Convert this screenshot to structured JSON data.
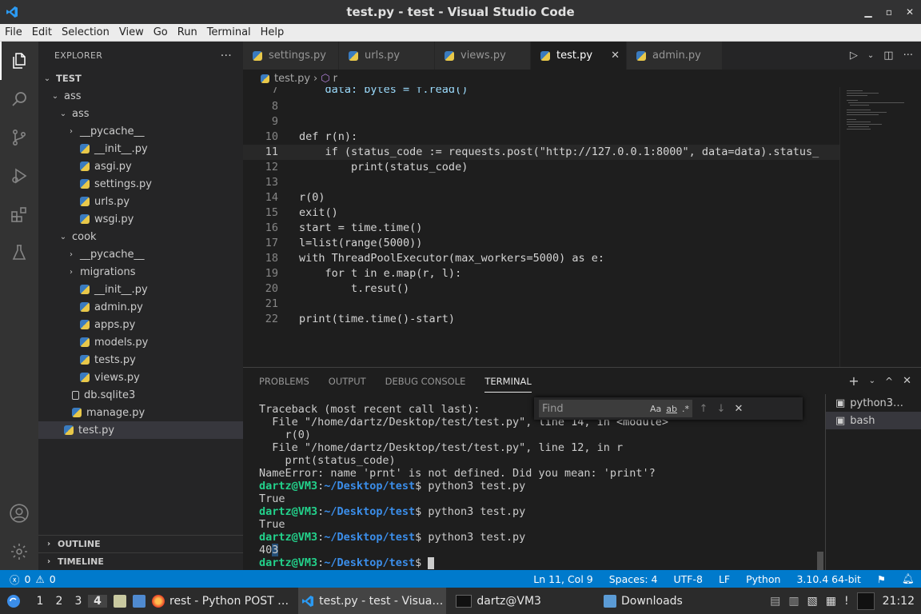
{
  "window": {
    "title": "test.py - test - Visual Studio Code"
  },
  "menu": [
    "File",
    "Edit",
    "Selection",
    "View",
    "Go",
    "Run",
    "Terminal",
    "Help"
  ],
  "explorer": {
    "header": "EXPLORER",
    "root": "TEST",
    "items": [
      {
        "label": "ass",
        "type": "folder-open"
      },
      {
        "label": "ass",
        "type": "folder-open"
      },
      {
        "label": "__pycache__",
        "type": "folder"
      },
      {
        "label": "__init__.py",
        "type": "py"
      },
      {
        "label": "asgi.py",
        "type": "py"
      },
      {
        "label": "settings.py",
        "type": "py"
      },
      {
        "label": "urls.py",
        "type": "py"
      },
      {
        "label": "wsgi.py",
        "type": "py"
      },
      {
        "label": "cook",
        "type": "folder-open"
      },
      {
        "label": "__pycache__",
        "type": "folder"
      },
      {
        "label": "migrations",
        "type": "folder"
      },
      {
        "label": "__init__.py",
        "type": "py"
      },
      {
        "label": "admin.py",
        "type": "py"
      },
      {
        "label": "apps.py",
        "type": "py"
      },
      {
        "label": "models.py",
        "type": "py"
      },
      {
        "label": "tests.py",
        "type": "py"
      },
      {
        "label": "views.py",
        "type": "py"
      },
      {
        "label": "db.sqlite3",
        "type": "db"
      },
      {
        "label": "manage.py",
        "type": "py"
      },
      {
        "label": "test.py",
        "type": "py"
      }
    ],
    "outline": "OUTLINE",
    "timeline": "TIMELINE"
  },
  "tabs": [
    "settings.py",
    "urls.py",
    "views.py",
    "test.py",
    "admin.py"
  ],
  "active_tab": "test.py",
  "breadcrumb": {
    "file": "test.py",
    "separator": "›",
    "symbol": "r"
  },
  "code": {
    "line_numbers": [
      "7",
      "8",
      "9",
      "10",
      "11",
      "12",
      "13",
      "14",
      "15",
      "16",
      "17",
      "18",
      "19",
      "20",
      "21",
      "22"
    ],
    "line7": "    data: bytes = f.read()",
    "line10": "def r(n):",
    "line11": "    if (status_code := requests.post(\"http://127.0.0.1:8000\", data=data).status_",
    "line12": "        print(status_code)",
    "line14": "r(0)",
    "line15": "exit()",
    "line16": "start = time.time()",
    "line17": "l=list(range(5000))",
    "line18": "with ThreadPoolExecutor(max_workers=5000) as e:",
    "line19": "    for t in e.map(r, l):",
    "line20": "        t.resut()",
    "line22": "print(time.time()-start)"
  },
  "panel": {
    "tabs": [
      "PROBLEMS",
      "OUTPUT",
      "DEBUG CONSOLE",
      "TERMINAL"
    ],
    "active": "TERMINAL",
    "find_placeholder": "Find",
    "find_opts": [
      "Aa",
      "ab",
      ".*"
    ],
    "terminal_lines": [
      "Traceback (most recent call last):",
      "  File \"/home/dartz/Desktop/test/test.py\", line 14, in <module>",
      "    r(0)",
      "  File \"/home/dartz/Desktop/test/test.py\", line 12, in r",
      "    prnt(status_code)",
      "NameError: name 'prnt' is not defined. Did you mean: 'print'?"
    ],
    "prompt_user": "dartz@VM3",
    "prompt_sep": ":",
    "prompt_path": "~/Desktop/test",
    "prompt_dollar": "$",
    "cmd": " python3 test.py",
    "out1": "True",
    "out2": "True",
    "out3a": "40",
    "out3b": "3",
    "terminals": [
      "python3…",
      "bash"
    ]
  },
  "status": {
    "errors": "0",
    "warnings": "0",
    "position": "Ln 11, Col 9",
    "spaces": "Spaces: 4",
    "encoding": "UTF-8",
    "eol": "LF",
    "language": "Python",
    "interpreter": "3.10.4 64-bit"
  },
  "taskbar": {
    "workspaces": [
      "1",
      "2",
      "3",
      "4"
    ],
    "active_workspace": "4",
    "windows": [
      "rest - Python POST …",
      "test.py - test - Visua…",
      "dartz@VM3",
      "Downloads"
    ],
    "clock": "21:12"
  },
  "colors": {
    "accent": "#007acc",
    "activity": "#333333",
    "sidebar": "#252526",
    "editor": "#1e1e1e"
  }
}
